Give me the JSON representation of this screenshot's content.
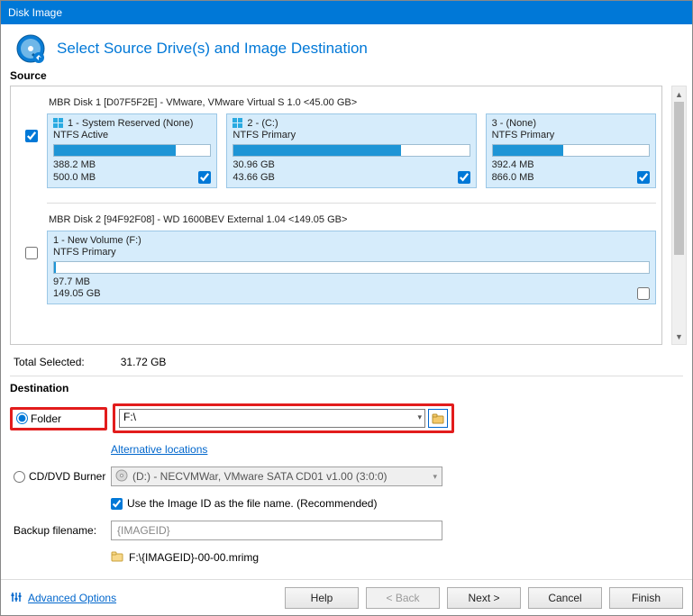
{
  "window": {
    "title": "Disk Image"
  },
  "header": {
    "title": "Select Source Drive(s) and Image Destination"
  },
  "source": {
    "label": "Source",
    "total_label": "Total Selected:",
    "total_value": "31.72 GB",
    "disks": [
      {
        "title": "MBR Disk 1 [D07F5F2E] - VMware,  VMware Virtual S 1.0  <45.00 GB>",
        "checked": true,
        "partitions": [
          {
            "name": "1 - System Reserved (None)",
            "fs": "NTFS Active",
            "used": "388.2 MB",
            "total": "500.0 MB",
            "fill": 78,
            "checked": true,
            "show_winicon": true
          },
          {
            "name": "2 -  (C:)",
            "fs": "NTFS Primary",
            "used": "30.96 GB",
            "total": "43.66 GB",
            "fill": 71,
            "checked": true,
            "show_winicon": true
          },
          {
            "name": "3 -  (None)",
            "fs": "NTFS Primary",
            "used": "392.4 MB",
            "total": "866.0 MB",
            "fill": 45,
            "checked": true,
            "show_winicon": false
          }
        ]
      },
      {
        "title": "MBR Disk 2 [94F92F08] - WD       1600BEV External 1.04  <149.05 GB>",
        "checked": false,
        "partitions": [
          {
            "name": "1 - New Volume (F:)",
            "fs": "NTFS Primary",
            "used": "97.7 MB",
            "total": "149.05 GB",
            "fill": 0.1,
            "checked": false,
            "show_winicon": false
          }
        ]
      }
    ]
  },
  "destination": {
    "label": "Destination",
    "folder_label": "Folder",
    "folder_value": "F:\\",
    "alt_locations": "Alternative locations",
    "cd_label": "CD/DVD Burner",
    "cd_value": "(D:) - NECVMWar, VMware SATA CD01 v1.00 (3:0:0)",
    "use_imageid_label": "Use the Image ID as the file name.  (Recommended)",
    "backup_filename_label": "Backup filename:",
    "backup_filename_value": "{IMAGEID}",
    "result_path": "F:\\{IMAGEID}-00-00.mrimg"
  },
  "footer": {
    "advanced": "Advanced Options",
    "help": "Help",
    "back": "< Back",
    "next": "Next >",
    "cancel": "Cancel",
    "finish": "Finish"
  }
}
